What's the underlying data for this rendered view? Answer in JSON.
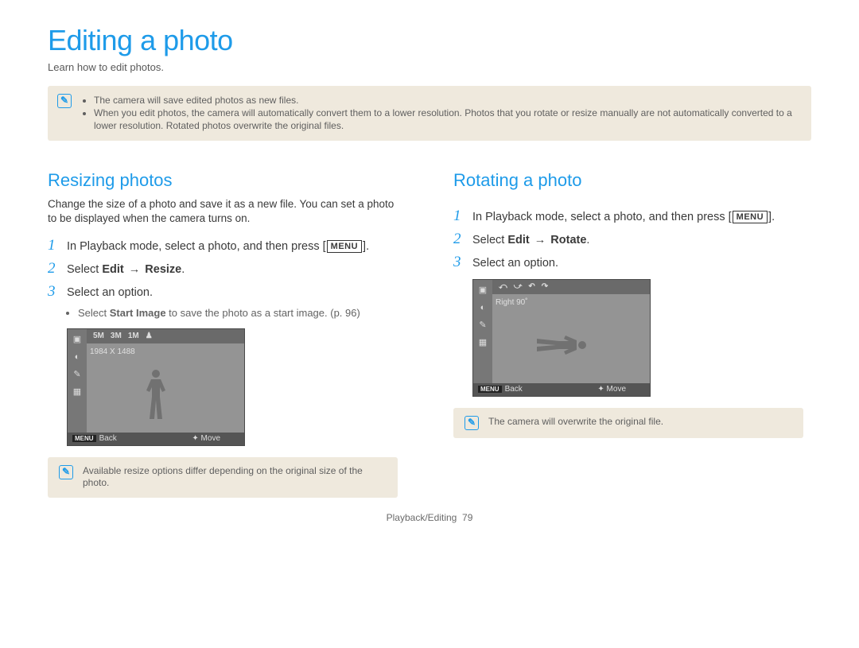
{
  "title": "Editing a photo",
  "subtitle": "Learn how to edit photos.",
  "top_note": {
    "bullets": [
      "The camera will save edited photos as new files.",
      "When you edit photos, the camera will automatically convert them to a lower resolution. Photos that you rotate or resize manually are not automatically converted to a lower resolution. Rotated photos overwrite the original files."
    ]
  },
  "left": {
    "heading": "Resizing photos",
    "desc": "Change the size of a photo and save it as a new file. You can set a photo to be displayed when the camera turns on.",
    "steps": {
      "s1_a": "In Playback mode, select a photo, and then press",
      "s1_menu": "MENU",
      "s1_b": ".",
      "s2_pre": "Select ",
      "s2_bold1": "Edit",
      "s2_arrow": "→",
      "s2_bold2": "Resize",
      "s2_post": ".",
      "s3": "Select an option.",
      "s3_sub_pre": "Select ",
      "s3_sub_bold": "Start Image",
      "s3_sub_post": " to save the photo as a start image. (p. 96)"
    },
    "lcd": {
      "size_options": [
        "5M",
        "3M",
        "1M"
      ],
      "label": "1984 X 1488",
      "bottom_back": "Back",
      "bottom_move": "Move",
      "menu_chip": "MENU",
      "nav_glyph": "✦"
    },
    "note": "Available resize options differ depending on the original size of the photo."
  },
  "right": {
    "heading": "Rotating a photo",
    "steps": {
      "s1_a": "In Playback mode, select a photo, and then press",
      "s1_menu": "MENU",
      "s1_b": ".",
      "s2_pre": "Select ",
      "s2_bold1": "Edit",
      "s2_arrow": "→",
      "s2_bold2": "Rotate",
      "s2_post": ".",
      "s3": "Select an option."
    },
    "lcd": {
      "rotate_icons": [
        "⤺",
        "⤻",
        "↶",
        "↷"
      ],
      "label": "Right 90˚",
      "bottom_back": "Back",
      "bottom_move": "Move",
      "menu_chip": "MENU",
      "nav_glyph": "✦"
    },
    "note": "The camera will overwrite the original file."
  },
  "footer": {
    "section": "Playback/Editing",
    "page": "79"
  },
  "icons": {
    "note_glyph": "✎"
  }
}
